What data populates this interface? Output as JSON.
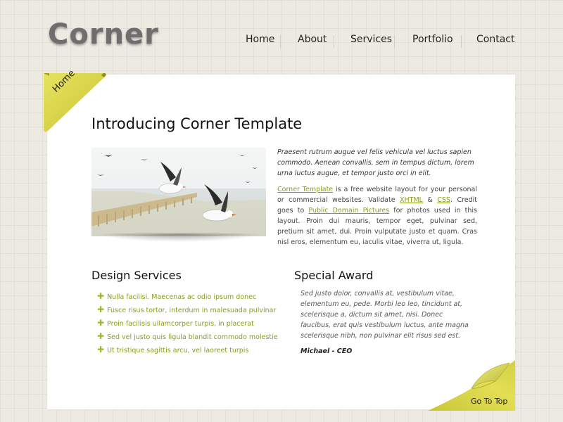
{
  "header": {
    "logo": "Corner"
  },
  "nav": {
    "items": [
      {
        "label": "Home"
      },
      {
        "label": "About"
      },
      {
        "label": "Services"
      },
      {
        "label": "Portfolio"
      },
      {
        "label": "Contact"
      }
    ]
  },
  "corner_tab": {
    "label": "Home"
  },
  "main": {
    "title": "Introducing Corner Template",
    "intro_italic": "Praesent rutrum augue vel felis vehicula vel luctus sapien commodo. Aenean convallis, sem in tempus dictum, lorem urna luctus augue, et tempor justo orci in elit.",
    "body": {
      "link_template": "Corner Template",
      "text1": " is a free website layout for your personal or commercial websites. Validate ",
      "link_xhtml": "XHTML",
      "text2": " & ",
      "link_css": "CSS",
      "text3": ". Credit goes to ",
      "link_pictures": "Public Domain Pictures",
      "text4": " for photos used in this layout. Proin dui mauris, tempor eget, pulvinar sed, pretium sit amet, dui. Proin vulputate justo et quam. Cras nisl eros, elementum eu, iaculis vitae, viverra ut, ligula."
    }
  },
  "design_services": {
    "title": "Design Services",
    "items": [
      "Nulla facilisi. Maecenas ac odio ipsum donec",
      "Fusce risus tortor, interdum in malesuada pulvinar",
      "Proin facilisis ullamcorper turpis, in placerat",
      "Sed vel justo quis ligula blandit commodo molestie",
      "Ut tristique sagittis arcu, vel laoreet turpis"
    ]
  },
  "special_award": {
    "title": "Special Award",
    "quote": "Sed justo dolor, convallis at, vestibulum vitae, elementum eu, pede. Morbi leo leo, tincidunt at, scelerisque a, dictum sit amet, nisi. Donec faucibus, erat quis vestibulum luctus, ante magna scelerisque nibh, non pulvinar elit risus sed est.",
    "author": "Michael - CEO"
  },
  "footer": {
    "go_top": "Go To Top"
  },
  "colors": {
    "accent": "#8d9a1c",
    "tab_yellow": "#d9d54a",
    "background": "#edeae2"
  },
  "icons": {
    "bullet": "plus-icon"
  }
}
